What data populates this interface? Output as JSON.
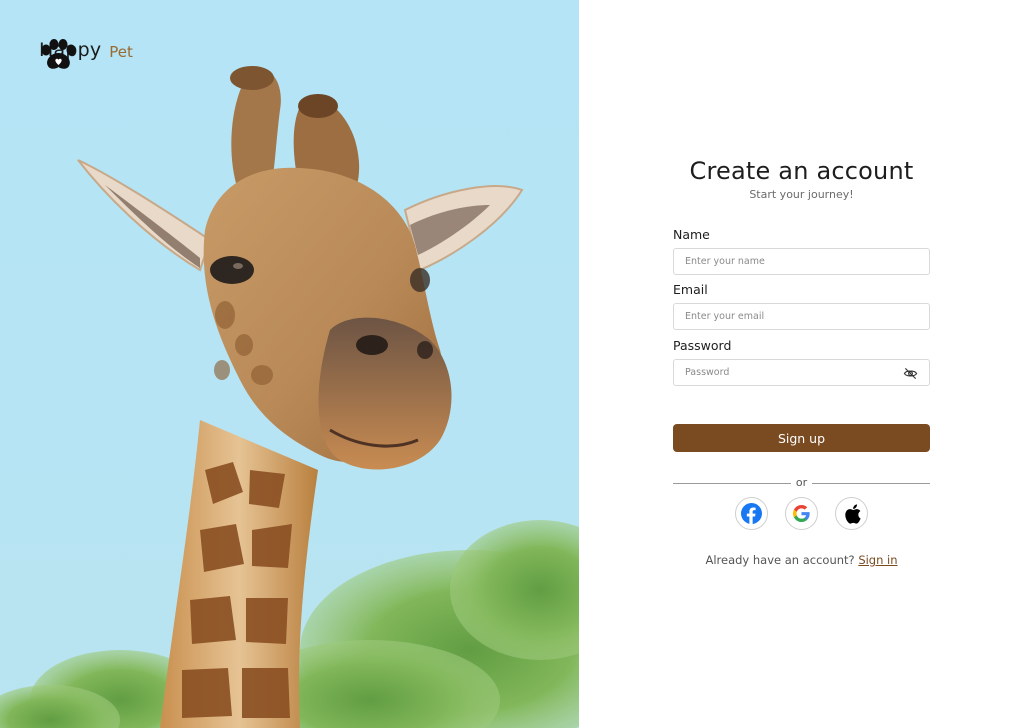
{
  "brand": {
    "name": "Happy",
    "sub": "Pet"
  },
  "hero": {
    "alt": "Giraffe"
  },
  "form": {
    "title": "Create an account",
    "subtitle": "Start your journey!",
    "fields": {
      "name": {
        "label": "Name",
        "placeholder": "Enter your name",
        "value": ""
      },
      "email": {
        "label": "Email",
        "placeholder": "Enter your email",
        "value": ""
      },
      "password": {
        "label": "Password",
        "placeholder": "Password",
        "value": ""
      }
    },
    "submit_label": "Sign up",
    "divider_text": "or",
    "social": [
      {
        "name": "facebook",
        "icon": "facebook-icon",
        "color": "#1877f2"
      },
      {
        "name": "google",
        "icon": "google-icon",
        "color": "#4285f4"
      },
      {
        "name": "apple",
        "icon": "apple-icon",
        "color": "#000000"
      }
    ],
    "signin_prompt": "Already have an account?",
    "signin_link": "Sign in"
  },
  "colors": {
    "accent": "#7a4a21",
    "brand_sub": "#9a6a2f",
    "sky": "#b4e4f5"
  }
}
